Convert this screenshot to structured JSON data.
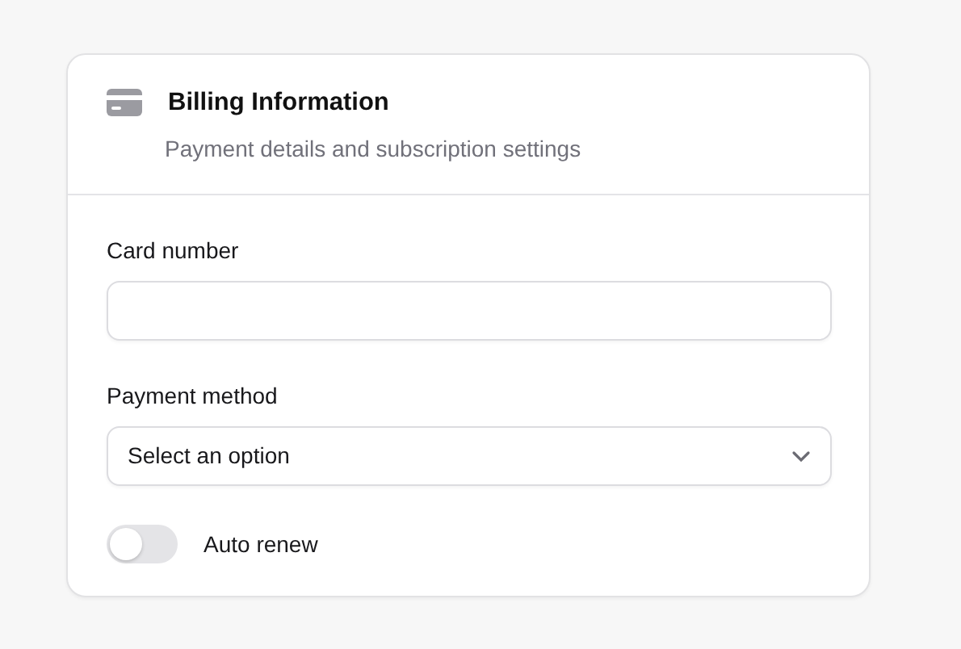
{
  "card": {
    "title": "Billing Information",
    "subtitle": "Payment details and subscription settings"
  },
  "fields": [
    {
      "kind": "text",
      "label": "Card number"
    },
    {
      "kind": "select",
      "label": "Payment method",
      "value": "Select an option"
    },
    {
      "kind": "toggle",
      "label": "Auto renew",
      "on": false
    }
  ]
}
